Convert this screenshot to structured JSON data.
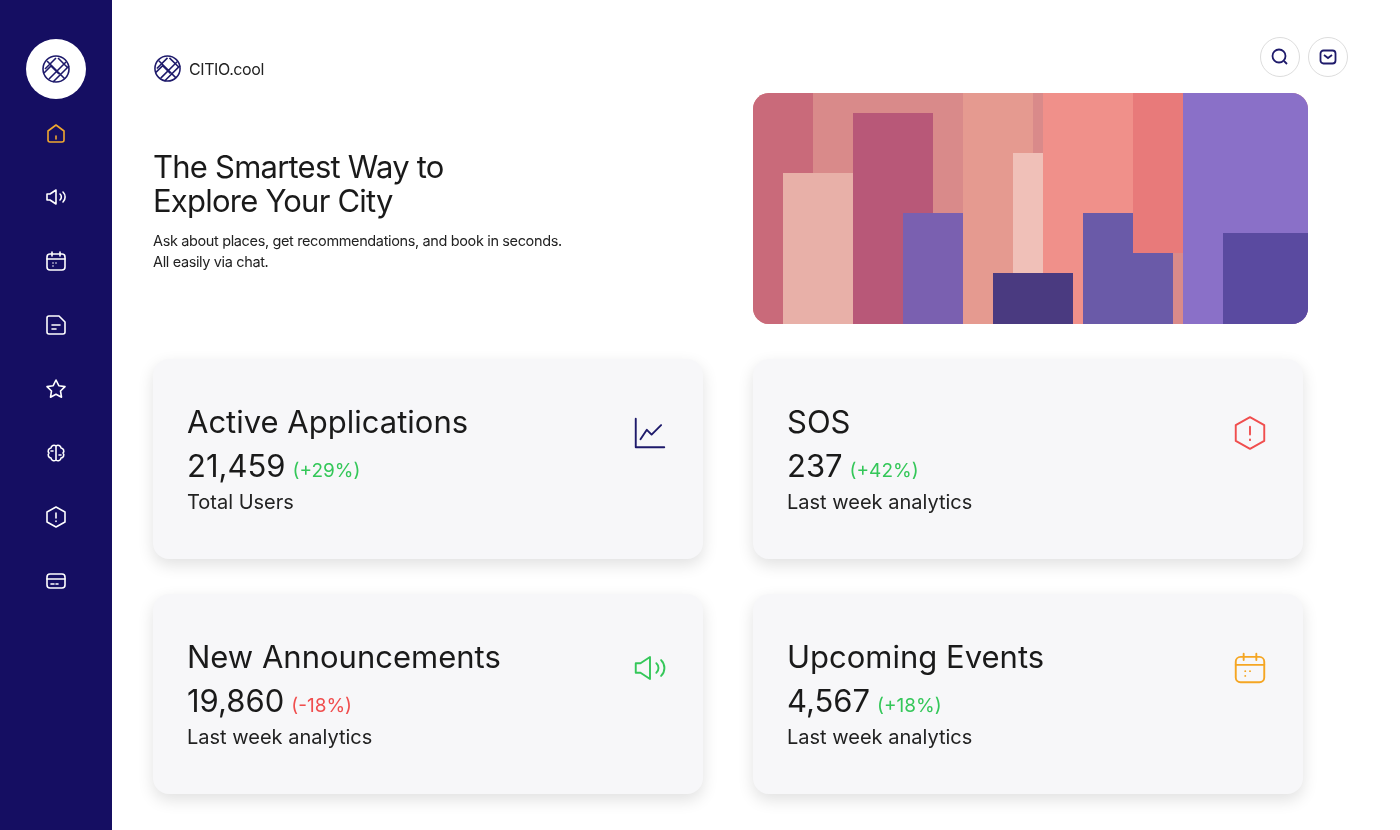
{
  "sidebar": {
    "items": [
      {
        "kind": "home",
        "selected": true
      },
      {
        "kind": "megaphone",
        "selected": false
      },
      {
        "kind": "calendar",
        "selected": false
      },
      {
        "kind": "note",
        "selected": false
      },
      {
        "kind": "star",
        "selected": false
      },
      {
        "kind": "brain",
        "selected": false
      },
      {
        "kind": "alert",
        "selected": false
      },
      {
        "kind": "card",
        "selected": false
      }
    ]
  },
  "brand": {
    "name": "CITIO.cool"
  },
  "hero": {
    "title": "The Smartest Way to Explore Your City",
    "subtitle": "Ask about places, get recommendations, and book in seconds.",
    "subtitle_2": "All easily via chat."
  },
  "cards": [
    {
      "kind": "chart",
      "title": "Active Applications",
      "value": "21,459",
      "change": {
        "text": "(+29%)",
        "color": "#34c759"
      },
      "caption": "Total Users",
      "color": "#1e1a6b"
    },
    {
      "kind": "alert",
      "title": "SOS",
      "value": "237",
      "change": {
        "text": "(+42%)",
        "color": "#34c759"
      },
      "caption": "Last week analytics",
      "color": "#f04e4e"
    },
    {
      "kind": "megaphone",
      "title": "New Announcements",
      "value": "19,860",
      "change": {
        "text": "(-18%)",
        "color": "#f04e4e"
      },
      "caption": "Last week analytics",
      "color": "#34c759"
    },
    {
      "kind": "calendar",
      "title": "Upcoming Events",
      "value": "4,567",
      "change": {
        "text": "(+18%)",
        "color": "#34c759"
      },
      "caption": "Last week analytics",
      "color": "#f5a623"
    }
  ]
}
